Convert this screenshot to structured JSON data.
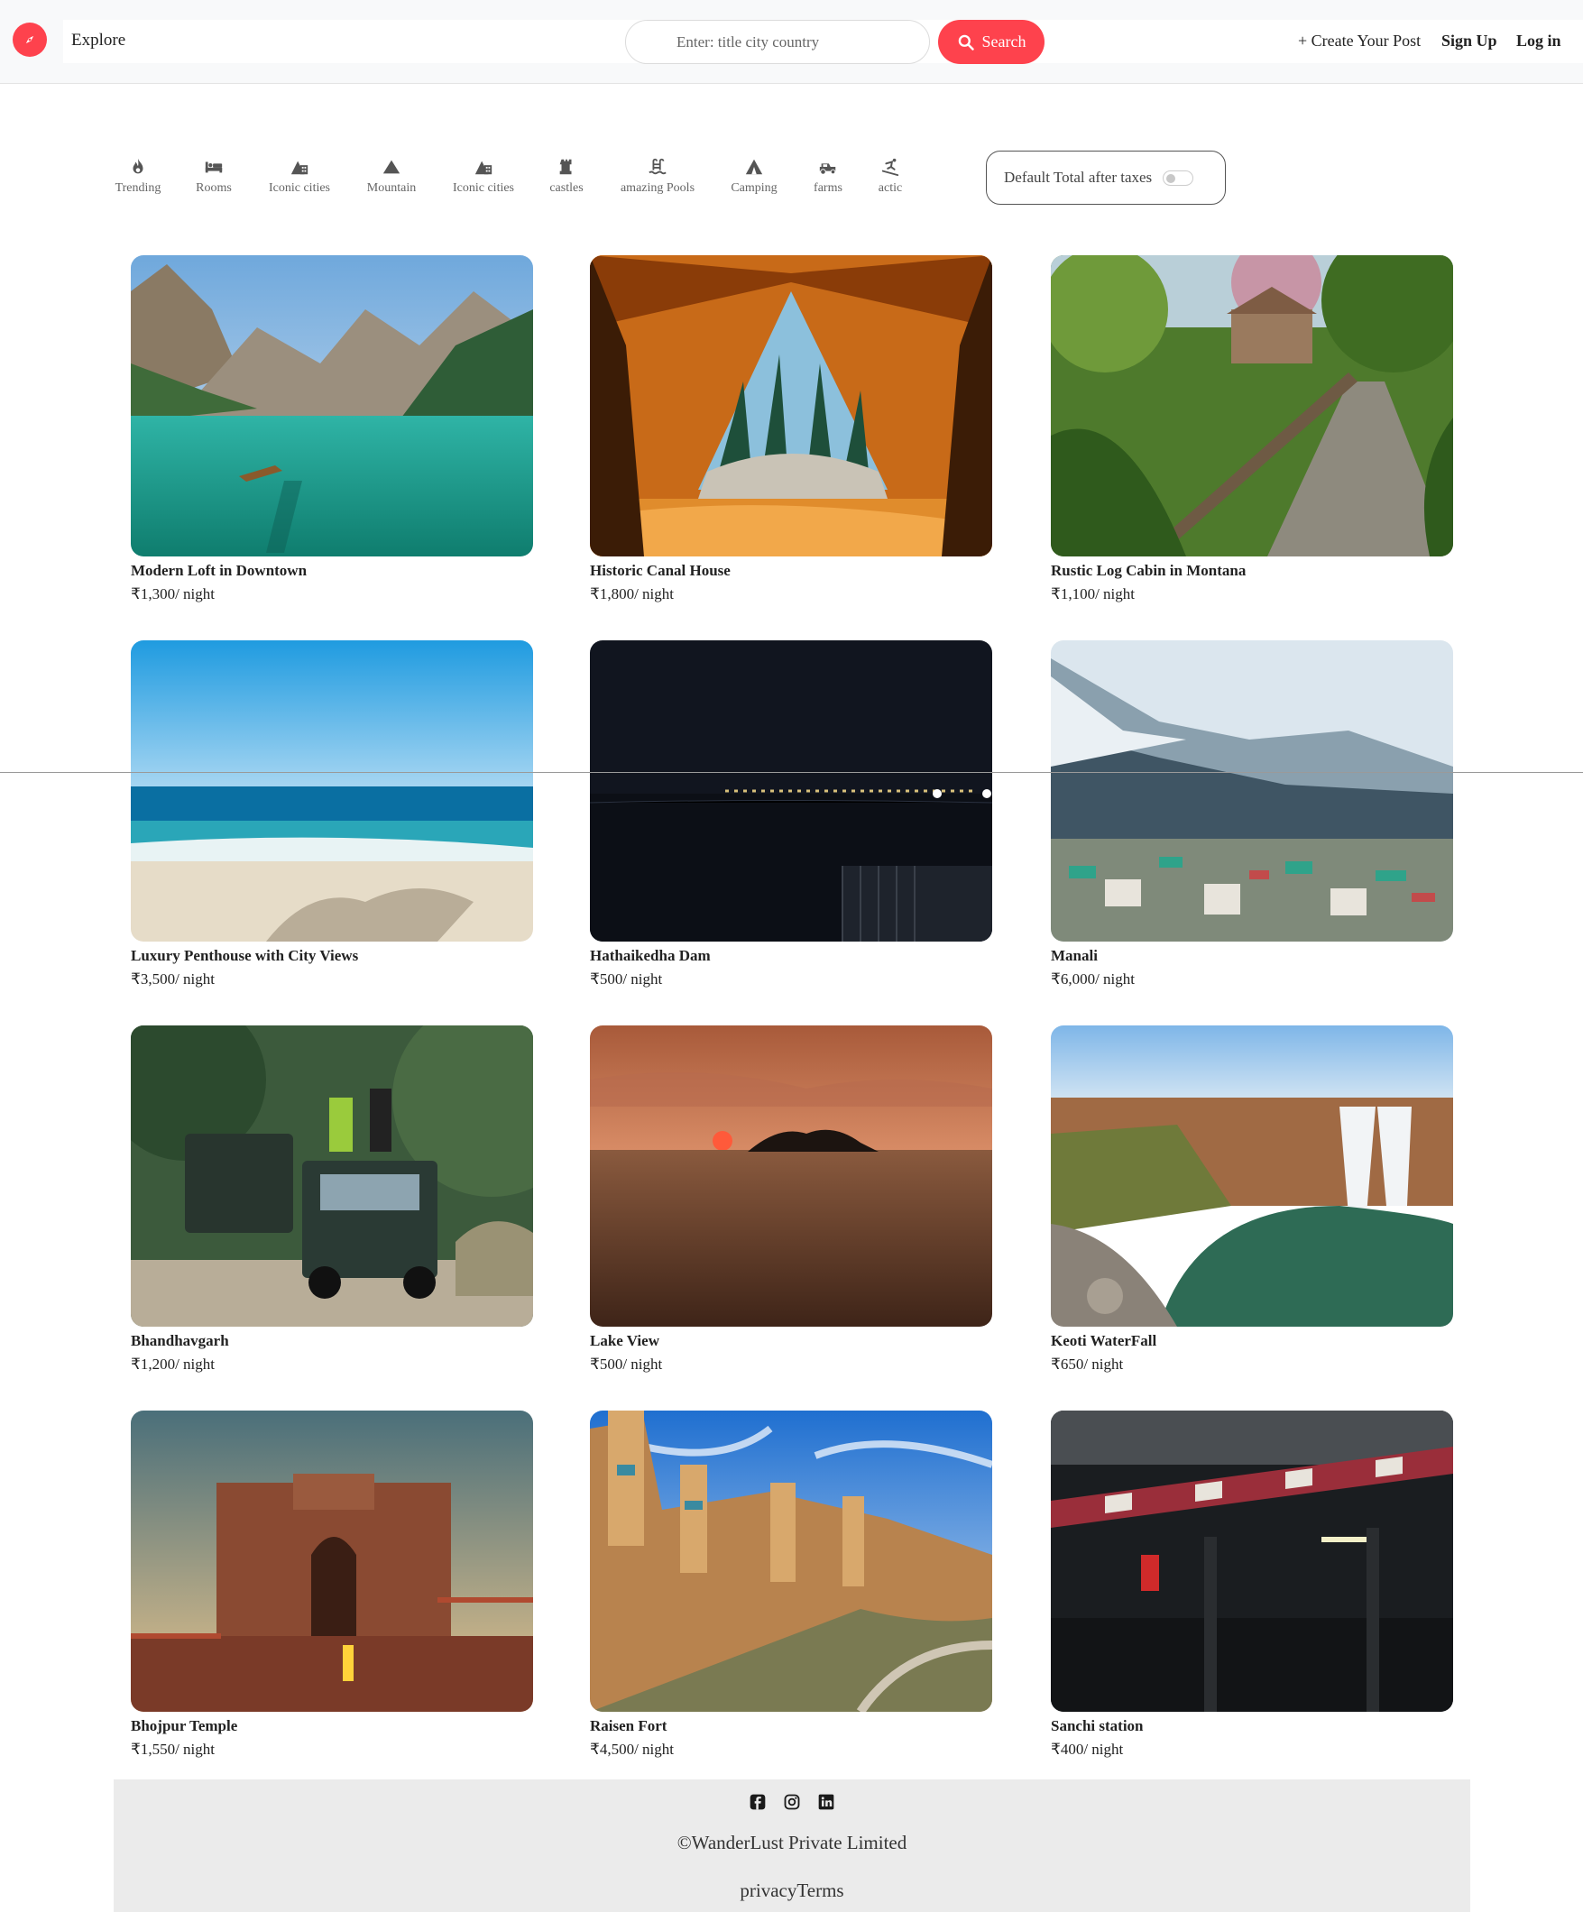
{
  "navbar": {
    "explore_label": "Explore",
    "search_placeholder": "Enter: title city country",
    "search_button": "Search",
    "create_post": "+ Create Your Post",
    "sign_up": "Sign Up",
    "log_in": "Log in",
    "accent_color": "#fe424d"
  },
  "filters": [
    {
      "label": "Trending",
      "icon": "fire-icon"
    },
    {
      "label": "Rooms",
      "icon": "bed-icon"
    },
    {
      "label": "Iconic cities",
      "icon": "city-icon"
    },
    {
      "label": "Mountain",
      "icon": "mountain-icon"
    },
    {
      "label": "Iconic cities",
      "icon": "city-icon"
    },
    {
      "label": "castles",
      "icon": "castle-icon"
    },
    {
      "label": "amazing Pools",
      "icon": "pool-icon"
    },
    {
      "label": "Camping",
      "icon": "tent-icon"
    },
    {
      "label": "farms",
      "icon": "tractor-icon"
    },
    {
      "label": "actic",
      "icon": "skier-icon"
    }
  ],
  "tax_toggle": {
    "label": "Default Total after taxes",
    "enabled": false
  },
  "listings": [
    {
      "title": "Modern Loft in Downtown",
      "price": "₹1,300",
      "unit": "/ night",
      "image": "mountain-lake-photo"
    },
    {
      "title": "Historic Canal House",
      "price": "₹1,800",
      "unit": "/ night",
      "image": "tent-forest-photo"
    },
    {
      "title": "Rustic Log Cabin in Montana",
      "price": "₹1,100",
      "unit": "/ night",
      "image": "garden-path-photo"
    },
    {
      "title": "Luxury Penthouse with City Views",
      "price": "₹3,500",
      "unit": "/ night",
      "image": "beach-photo"
    },
    {
      "title": "Hathaikedha Dam",
      "price": "₹500",
      "unit": "/ night",
      "image": "night-dam-photo"
    },
    {
      "title": "Manali",
      "price": "₹6,000",
      "unit": "/ night",
      "image": "snowy-town-photo"
    },
    {
      "title": "Bhandhavgarh",
      "price": "₹1,200",
      "unit": "/ night",
      "image": "safari-jeeps-photo"
    },
    {
      "title": "Lake View",
      "price": "₹500",
      "unit": "/ night",
      "image": "sunset-lake-photo"
    },
    {
      "title": "Keoti WaterFall",
      "price": "₹650",
      "unit": "/ night",
      "image": "waterfall-photo"
    },
    {
      "title": "Bhojpur Temple",
      "price": "₹1,550",
      "unit": "/ night",
      "image": "temple-photo"
    },
    {
      "title": "Raisen Fort",
      "price": "₹4,500",
      "unit": "/ night",
      "image": "fort-photo"
    },
    {
      "title": "Sanchi station",
      "price": "₹400",
      "unit": "/ night",
      "image": "railway-station-photo"
    }
  ],
  "footer": {
    "social_icons": [
      "facebook-icon",
      "instagram-icon",
      "linkedin-icon"
    ],
    "copyright": "©WanderLust Private Limited",
    "privacy": "privacy",
    "terms": "Terms"
  }
}
